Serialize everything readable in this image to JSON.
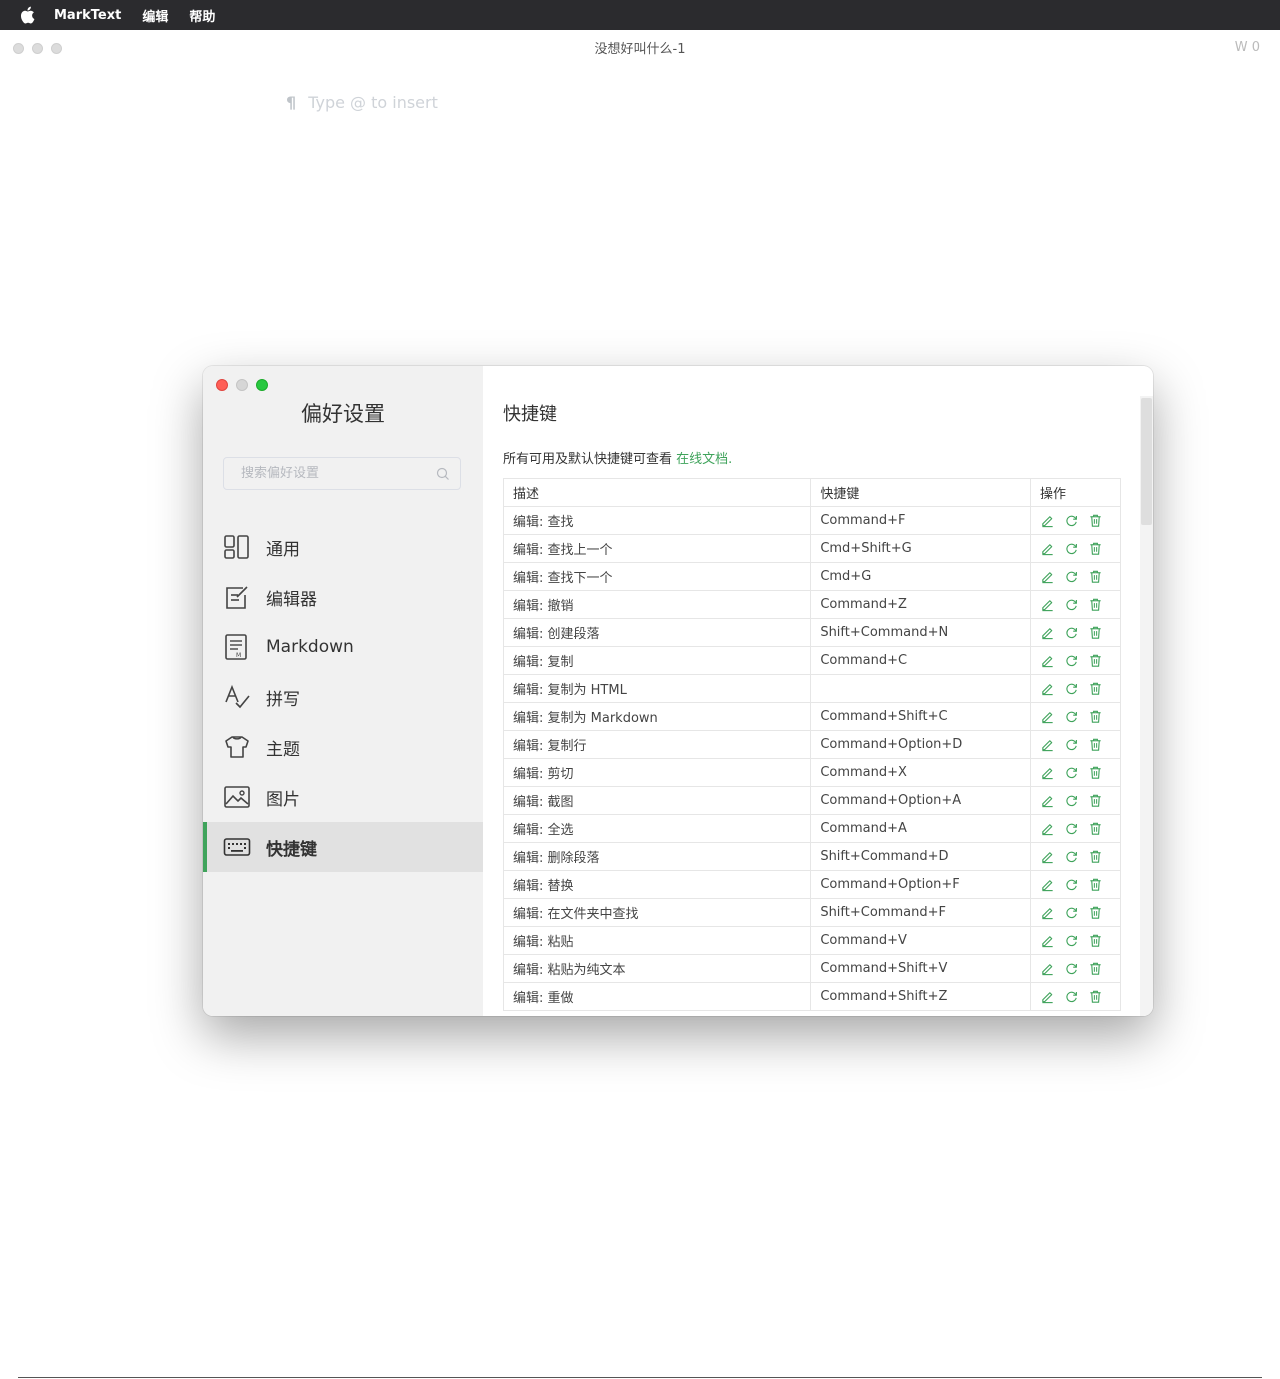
{
  "menubar": {
    "app_name": "MarkText",
    "items": [
      "编辑",
      "帮助"
    ]
  },
  "main_window": {
    "title": "没想好叫什么-1",
    "word_count": "W 0",
    "editor_placeholder": "Type @ to insert",
    "paragraph_icon": "¶"
  },
  "preferences": {
    "title": "偏好设置",
    "search_placeholder": "搜索偏好设置",
    "nav": [
      {
        "label": "通用",
        "icon": "general-icon"
      },
      {
        "label": "编辑器",
        "icon": "editor-icon"
      },
      {
        "label": "Markdown",
        "icon": "markdown-icon"
      },
      {
        "label": "拼写",
        "icon": "spelling-icon"
      },
      {
        "label": "主题",
        "icon": "theme-icon"
      },
      {
        "label": "图片",
        "icon": "image-icon"
      },
      {
        "label": "快捷键",
        "icon": "keyboard-icon",
        "active": true
      }
    ],
    "accent_color": "#3fa35b",
    "section_title": "快捷键",
    "description": "所有可用及默认快捷键可查看",
    "description_link": "在线文档.",
    "table": {
      "headers": [
        "描述",
        "快捷键",
        "操作"
      ],
      "rows": [
        {
          "desc": "编辑: 查找",
          "key": "Command+F"
        },
        {
          "desc": "编辑: 查找上一个",
          "key": "Cmd+Shift+G"
        },
        {
          "desc": "编辑: 查找下一个",
          "key": "Cmd+G"
        },
        {
          "desc": "编辑: 撤销",
          "key": "Command+Z"
        },
        {
          "desc": "编辑: 创建段落",
          "key": "Shift+Command+N"
        },
        {
          "desc": "编辑: 复制",
          "key": "Command+C"
        },
        {
          "desc": "编辑: 复制为 HTML",
          "key": ""
        },
        {
          "desc": "编辑: 复制为 Markdown",
          "key": "Command+Shift+C"
        },
        {
          "desc": "编辑: 复制行",
          "key": "Command+Option+D"
        },
        {
          "desc": "编辑: 剪切",
          "key": "Command+X"
        },
        {
          "desc": "编辑: 截图",
          "key": "Command+Option+A"
        },
        {
          "desc": "编辑: 全选",
          "key": "Command+A"
        },
        {
          "desc": "编辑: 删除段落",
          "key": "Shift+Command+D"
        },
        {
          "desc": "编辑: 替换",
          "key": "Command+Option+F"
        },
        {
          "desc": "编辑: 在文件夹中查找",
          "key": "Shift+Command+F"
        },
        {
          "desc": "编辑: 粘贴",
          "key": "Command+V"
        },
        {
          "desc": "编辑: 粘贴为纯文本",
          "key": "Command+Shift+V"
        },
        {
          "desc": "编辑: 重做",
          "key": "Command+Shift+Z"
        }
      ],
      "row_actions": [
        "edit-icon",
        "reset-icon",
        "delete-icon"
      ]
    }
  }
}
